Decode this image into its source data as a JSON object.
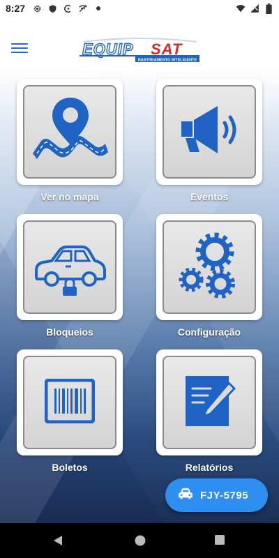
{
  "status_bar": {
    "time": "8:27",
    "left_icons": [
      "gear-icon",
      "shield-icon",
      "vpn-icon",
      "signal-off-icon",
      "dot-icon"
    ],
    "right_icons": [
      "wifi-icon",
      "cell-signal-icon",
      "battery-icon"
    ]
  },
  "header": {
    "logo_text": "EQUIPSAT",
    "logo_tagline": "RASTREAMENTO INTELIGENTE",
    "menu_icon": "hamburger-menu-icon"
  },
  "tiles": [
    {
      "label": "Ver no mapa",
      "icon": "map-pin-route-icon"
    },
    {
      "label": "Eventos",
      "icon": "megaphone-icon"
    },
    {
      "label": "Bloqueios",
      "icon": "car-lock-icon"
    },
    {
      "label": "Configuração",
      "icon": "gears-icon"
    },
    {
      "label": "Boletos",
      "icon": "barcode-icon"
    },
    {
      "label": "Relatórios",
      "icon": "report-pen-icon"
    }
  ],
  "fab": {
    "plate": "FJY-5795",
    "icon": "car-icon"
  },
  "colors": {
    "accent": "#2f8ff0",
    "icon_blue": "#1f63c4",
    "logo_red": "#d42a2a"
  }
}
